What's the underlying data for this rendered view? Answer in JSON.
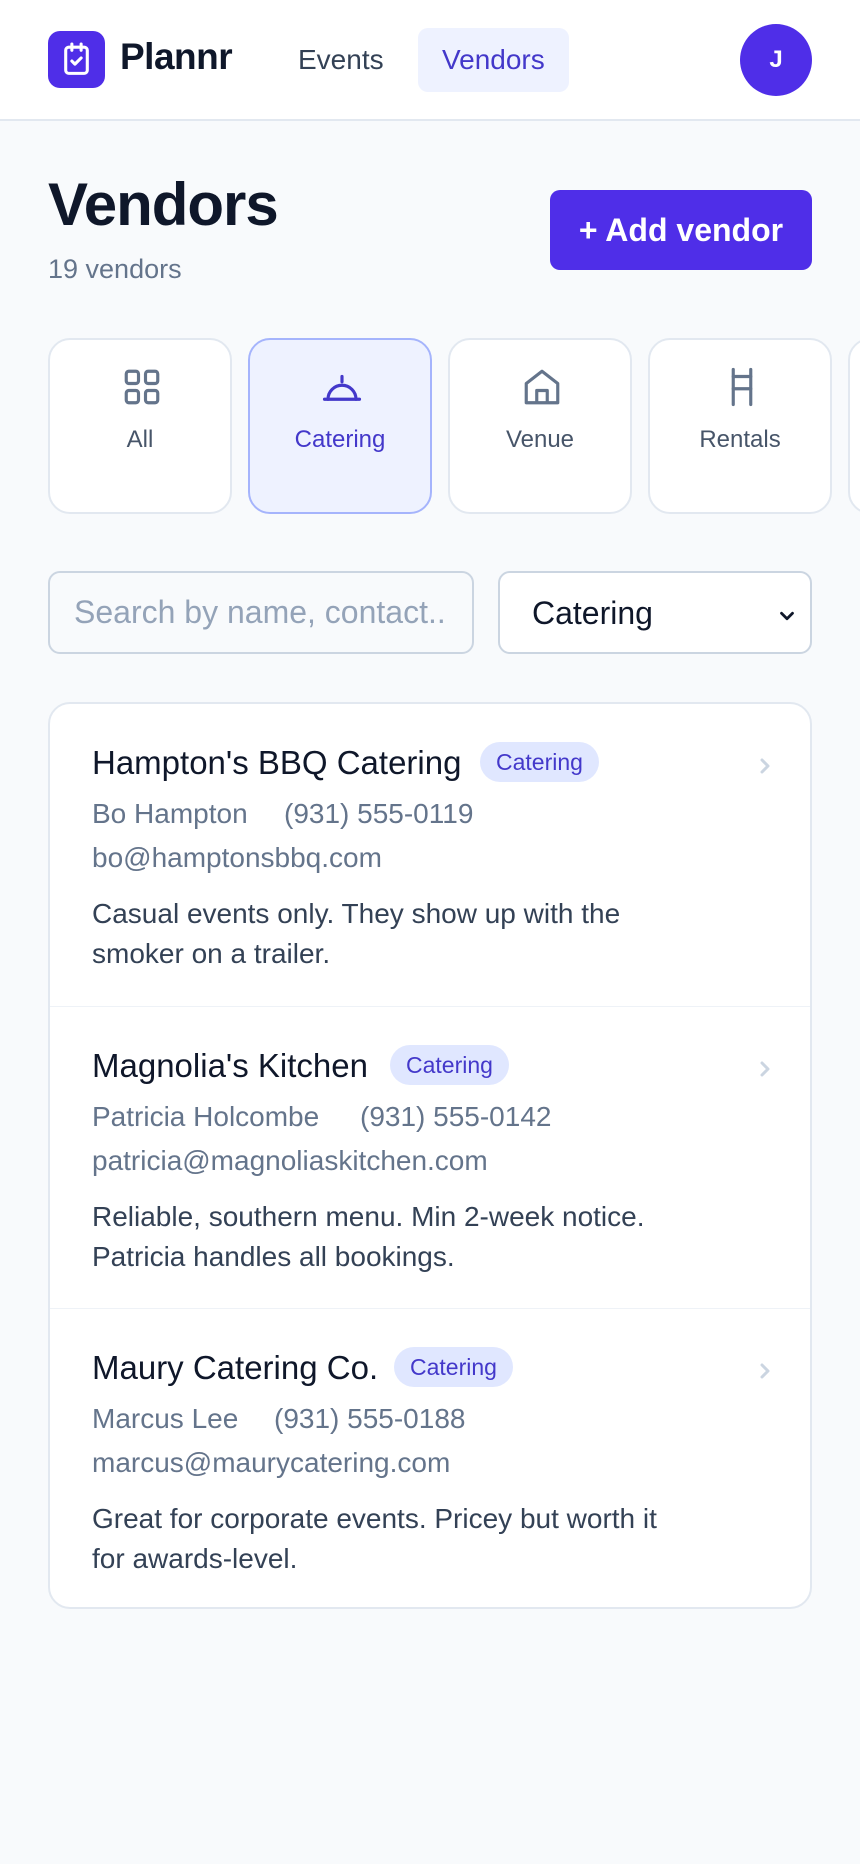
{
  "app": {
    "brand": "Plannr"
  },
  "nav": {
    "events": "Events",
    "vendors": "Vendors",
    "avatar_initial": "J"
  },
  "page": {
    "title": "Vendors",
    "count": "19 vendors",
    "add_button": "+ Add vendor"
  },
  "categories": [
    {
      "label": "All",
      "icon": "grid-icon",
      "active": false
    },
    {
      "label": "Catering",
      "icon": "cloche-icon",
      "active": true
    },
    {
      "label": "Venue",
      "icon": "house-icon",
      "active": false
    },
    {
      "label": "Rentals",
      "icon": "chair-icon",
      "active": false
    }
  ],
  "filters": {
    "search_placeholder": "Search by name, contact...",
    "category_selected": "Catering"
  },
  "vendors": [
    {
      "name": "Hampton's BBQ Catering",
      "badge": "Catering",
      "contact": "Bo Hampton",
      "phone": "(931) 555-0119",
      "email": "bo@hamptonsbbq.com",
      "note": "Casual events only. They show up with the smoker on a trailer."
    },
    {
      "name": "Magnolia's Kitchen",
      "badge": "Catering",
      "contact": "Patricia Holcombe",
      "phone": "(931) 555-0142",
      "email": "patricia@magnoliaskitchen.com",
      "note": "Reliable, southern menu. Min 2-week notice. Patricia handles all bookings."
    },
    {
      "name": "Maury Catering Co.",
      "badge": "Catering",
      "contact": "Marcus Lee",
      "phone": "(931) 555-0188",
      "email": "marcus@maurycatering.com",
      "note": "Great for corporate events. Pricey but worth it for awards-level."
    }
  ],
  "colors": {
    "accent": "#4f2ee8",
    "accent_soft": "#eef2ff",
    "badge_text": "#4338ca"
  }
}
